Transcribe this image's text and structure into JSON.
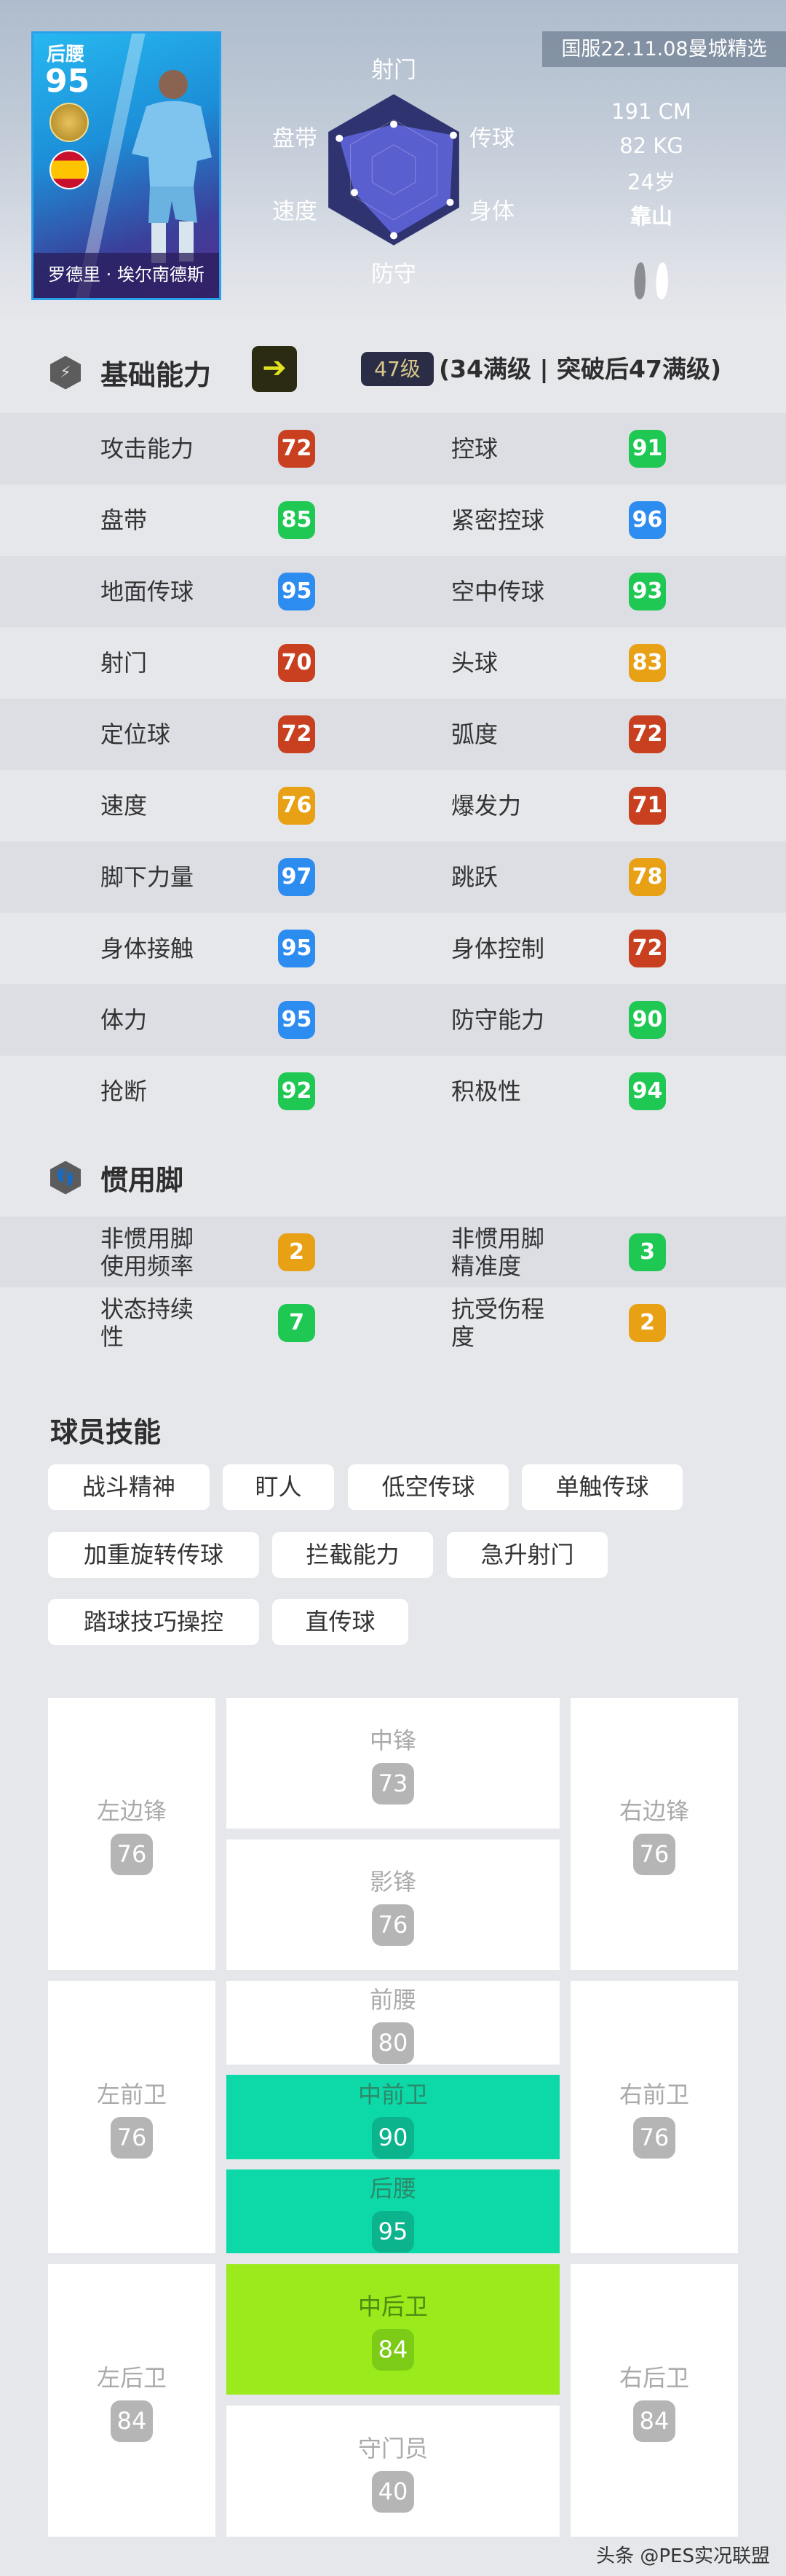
{
  "card": {
    "position": "后腰",
    "overall": "95",
    "name": "罗德里 · 埃尔南德斯",
    "version_tag": "国服22.11.08曼城精选"
  },
  "radar": {
    "axes": [
      "射门",
      "传球",
      "身体",
      "防守",
      "速度",
      "盘带"
    ],
    "values": [
      0.6,
      0.91,
      0.86,
      0.87,
      0.6,
      0.83
    ],
    "colors": {
      "outer": "#2f3370",
      "fill": "#5a5fd0"
    }
  },
  "info": {
    "height": "191 CM",
    "weight": "82 KG",
    "age": "24岁",
    "style": "靠山",
    "foot_icon": "feet-icon"
  },
  "basic": {
    "title": "基础能力",
    "level": "47级",
    "level_note": "(34满级 | 突破后47满级)",
    "rows": [
      [
        {
          "label": "攻击能力",
          "value": "72"
        },
        {
          "label": "控球",
          "value": "91"
        }
      ],
      [
        {
          "label": "盘带",
          "value": "85"
        },
        {
          "label": "紧密控球",
          "value": "96"
        }
      ],
      [
        {
          "label": "地面传球",
          "value": "95"
        },
        {
          "label": "空中传球",
          "value": "93"
        }
      ],
      [
        {
          "label": "射门",
          "value": "70"
        },
        {
          "label": "头球",
          "value": "83"
        }
      ],
      [
        {
          "label": "定位球",
          "value": "72"
        },
        {
          "label": "弧度",
          "value": "72"
        }
      ],
      [
        {
          "label": "速度",
          "value": "76"
        },
        {
          "label": "爆发力",
          "value": "71"
        }
      ],
      [
        {
          "label": "脚下力量",
          "value": "97"
        },
        {
          "label": "跳跃",
          "value": "78"
        }
      ],
      [
        {
          "label": "身体接触",
          "value": "95"
        },
        {
          "label": "身体控制",
          "value": "72"
        }
      ],
      [
        {
          "label": "体力",
          "value": "95"
        },
        {
          "label": "防守能力",
          "value": "90"
        }
      ],
      [
        {
          "label": "抢断",
          "value": "92"
        },
        {
          "label": "积极性",
          "value": "94"
        }
      ]
    ]
  },
  "foot": {
    "title": "惯用脚",
    "rows": [
      [
        {
          "label": "非惯用脚\n使用频率",
          "value": "2",
          "color": "#e8a015"
        },
        {
          "label": "非惯用脚\n精准度",
          "value": "3",
          "color": "#1ec853"
        }
      ],
      [
        {
          "label": "状态持续\n性",
          "value": "7",
          "color": "#1ec853"
        },
        {
          "label": "抗受伤程\n度",
          "value": "2",
          "color": "#e8a015"
        }
      ]
    ]
  },
  "skills": {
    "title": "球员技能",
    "items": [
      "战斗精神",
      "盯人",
      "低空传球",
      "单触传球",
      "加重旋转传球",
      "拦截能力",
      "急升射门",
      "踏球技巧操控",
      "直传球"
    ]
  },
  "positions": [
    {
      "name": "左边锋",
      "value": "76"
    },
    {
      "name": "中锋",
      "value": "73"
    },
    {
      "name": "影锋",
      "value": "76"
    },
    {
      "name": "右边锋",
      "value": "76"
    },
    {
      "name": "左前卫",
      "value": "76"
    },
    {
      "name": "前腰",
      "value": "80"
    },
    {
      "name": "中前卫",
      "value": "90",
      "highlight": "teal"
    },
    {
      "name": "后腰",
      "value": "95",
      "highlight": "teal"
    },
    {
      "name": "右前卫",
      "value": "76"
    },
    {
      "name": "左后卫",
      "value": "84"
    },
    {
      "name": "中后卫",
      "value": "84",
      "highlight": "lime"
    },
    {
      "name": "守门员",
      "value": "40"
    },
    {
      "name": "右后卫",
      "value": "84"
    }
  ],
  "badge_colors": {
    "blue": "#2d8cf0",
    "green": "#1ec853",
    "orange": "#e8a015",
    "red": "#c8401f"
  },
  "watermark": "头条 @PES实况联盟"
}
